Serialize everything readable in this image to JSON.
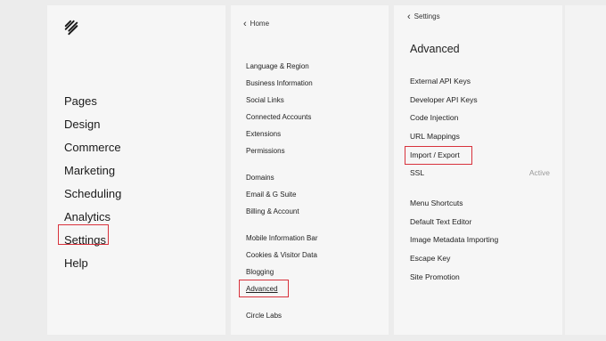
{
  "main_menu": {
    "items": [
      {
        "label": "Pages"
      },
      {
        "label": "Design"
      },
      {
        "label": "Commerce"
      },
      {
        "label": "Marketing"
      },
      {
        "label": "Scheduling"
      },
      {
        "label": "Analytics"
      },
      {
        "label": "Settings"
      },
      {
        "label": "Help"
      }
    ]
  },
  "settings_menu": {
    "back_label": "Home",
    "groups": [
      [
        "Language & Region",
        "Business Information",
        "Social Links",
        "Connected Accounts",
        "Extensions",
        "Permissions"
      ],
      [
        "Domains",
        "Email & G Suite",
        "Billing & Account"
      ],
      [
        "Mobile Information Bar",
        "Cookies & Visitor Data",
        "Blogging",
        "Advanced"
      ],
      [
        "Circle Labs"
      ]
    ]
  },
  "advanced_menu": {
    "back_label": "Settings",
    "title": "Advanced",
    "groups": [
      [
        {
          "label": "External API Keys",
          "status": ""
        },
        {
          "label": "Developer API Keys",
          "status": ""
        },
        {
          "label": "Code Injection",
          "status": ""
        },
        {
          "label": "URL Mappings",
          "status": ""
        },
        {
          "label": "Import / Export",
          "status": ""
        },
        {
          "label": "SSL",
          "status": "Active"
        }
      ],
      [
        {
          "label": "Menu Shortcuts"
        },
        {
          "label": "Default Text Editor"
        },
        {
          "label": "Image Metadata Importing"
        },
        {
          "label": "Escape Key"
        },
        {
          "label": "Site Promotion"
        }
      ]
    ]
  },
  "highlight_color": "#d8323c"
}
